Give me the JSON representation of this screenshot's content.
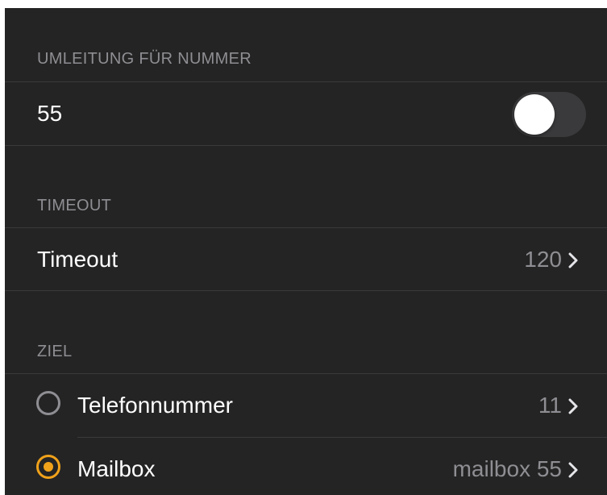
{
  "colors": {
    "background": "#242424",
    "separator": "#3a3a3c",
    "header_text": "#8e8e93",
    "primary_text": "#ffffff",
    "secondary_text": "#8e8e93",
    "accent": "#f0a21a"
  },
  "sections": {
    "redirect": {
      "header": "UMLEITUNG FÜR NUMMER",
      "row": {
        "label": "55",
        "toggle_on": false
      }
    },
    "timeout": {
      "header": "TIMEOUT",
      "row": {
        "label": "Timeout",
        "value": "120",
        "icon": "chevron-right-icon"
      }
    },
    "target": {
      "header": "ZIEL",
      "options": [
        {
          "label": "Telefonnummer",
          "value": "11",
          "selected": false,
          "icon": "chevron-right-icon"
        },
        {
          "label": "Mailbox",
          "value": "mailbox 55",
          "selected": true,
          "icon": "chevron-right-icon"
        }
      ]
    }
  }
}
